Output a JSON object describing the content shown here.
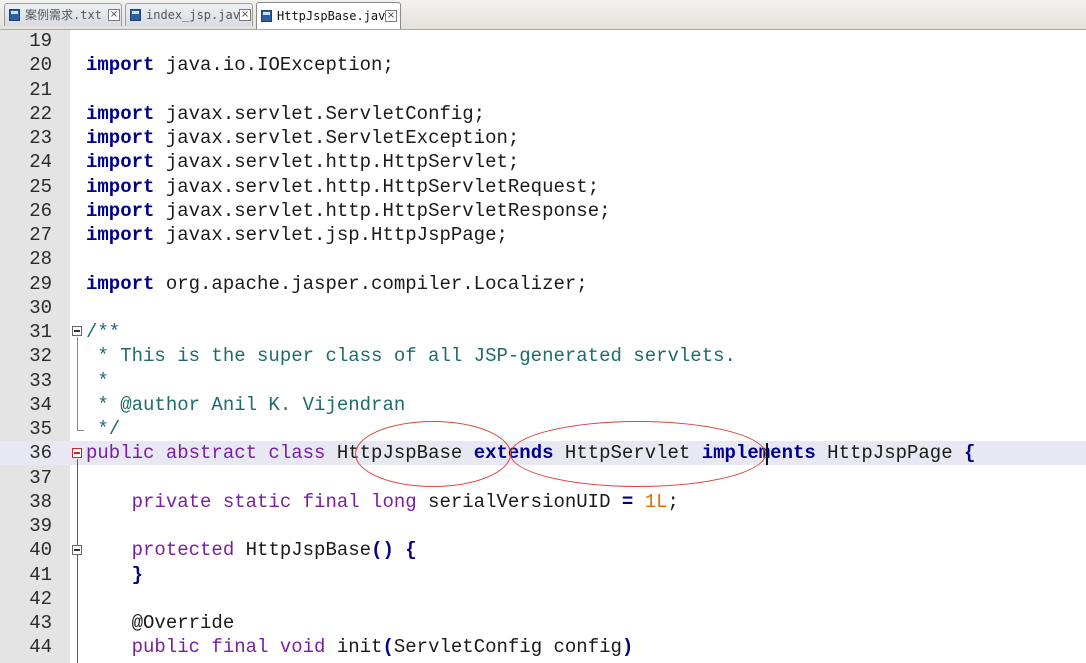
{
  "tabs": [
    {
      "label": "案例需求.txt",
      "active": false
    },
    {
      "label": "index_jsp.java",
      "active": false
    },
    {
      "label": "HttpJspBase.java",
      "active": true
    }
  ],
  "code": {
    "lines": [
      {
        "n": "19",
        "html": ""
      },
      {
        "n": "20",
        "html": "<span class=\"kw\">import</span> java.io.IOException;"
      },
      {
        "n": "21",
        "html": ""
      },
      {
        "n": "22",
        "html": "<span class=\"kw\">import</span> javax.servlet.ServletConfig;"
      },
      {
        "n": "23",
        "html": "<span class=\"kw\">import</span> javax.servlet.ServletException;"
      },
      {
        "n": "24",
        "html": "<span class=\"kw\">import</span> javax.servlet.http.HttpServlet;"
      },
      {
        "n": "25",
        "html": "<span class=\"kw\">import</span> javax.servlet.http.HttpServletRequest;"
      },
      {
        "n": "26",
        "html": "<span class=\"kw\">import</span> javax.servlet.http.HttpServletResponse;"
      },
      {
        "n": "27",
        "html": "<span class=\"kw\">import</span> javax.servlet.jsp.HttpJspPage;"
      },
      {
        "n": "28",
        "html": ""
      },
      {
        "n": "29",
        "html": "<span class=\"kw\">import</span> org.apache.jasper.compiler.Localizer;"
      },
      {
        "n": "30",
        "html": ""
      },
      {
        "n": "31",
        "html": "<span class=\"cm\">/**</span>"
      },
      {
        "n": "32",
        "html": "<span class=\"cm\"> * This is the super class of all JSP-generated servlets.</span>"
      },
      {
        "n": "33",
        "html": "<span class=\"cm\"> *</span>"
      },
      {
        "n": "34",
        "html": "<span class=\"cm\"> * @author Anil K. Vijendran</span>"
      },
      {
        "n": "35",
        "html": "<span class=\"cm\"> */</span>"
      },
      {
        "n": "36",
        "html": "<span class=\"kw2\">public abstract class</span> HttpJspBase <span class=\"kw\">extends</span> HttpServlet <span class=\"kw\">implements</span> HttpJspPage <span class=\"op\">{</span>"
      },
      {
        "n": "37",
        "html": ""
      },
      {
        "n": "38",
        "html": "    <span class=\"kw2\">private static final long</span> serialVersionUID <span class=\"op\">=</span> <span class=\"num\">1L</span>;"
      },
      {
        "n": "39",
        "html": ""
      },
      {
        "n": "40",
        "html": "    <span class=\"kw2\">protected</span> HttpJspBase<span class=\"op\">()</span> <span class=\"op\">{</span>"
      },
      {
        "n": "41",
        "html": "    <span class=\"op\">}</span>"
      },
      {
        "n": "42",
        "html": ""
      },
      {
        "n": "43",
        "html": "    @Override"
      },
      {
        "n": "44",
        "html": "    <span class=\"kw2\">public final void</span> init<span class=\"op\">(</span>ServletConfig config<span class=\"op\">)</span>"
      }
    ]
  },
  "colors": {
    "keyword": "#00008b",
    "modifier": "#7a1fa0",
    "comment": "#1e6b6b",
    "number": "#e07000",
    "annotation_ellipse": "#d9453a"
  },
  "icons": {
    "file": "file-icon",
    "close": "close-icon",
    "fold": "fold-toggle-icon"
  }
}
